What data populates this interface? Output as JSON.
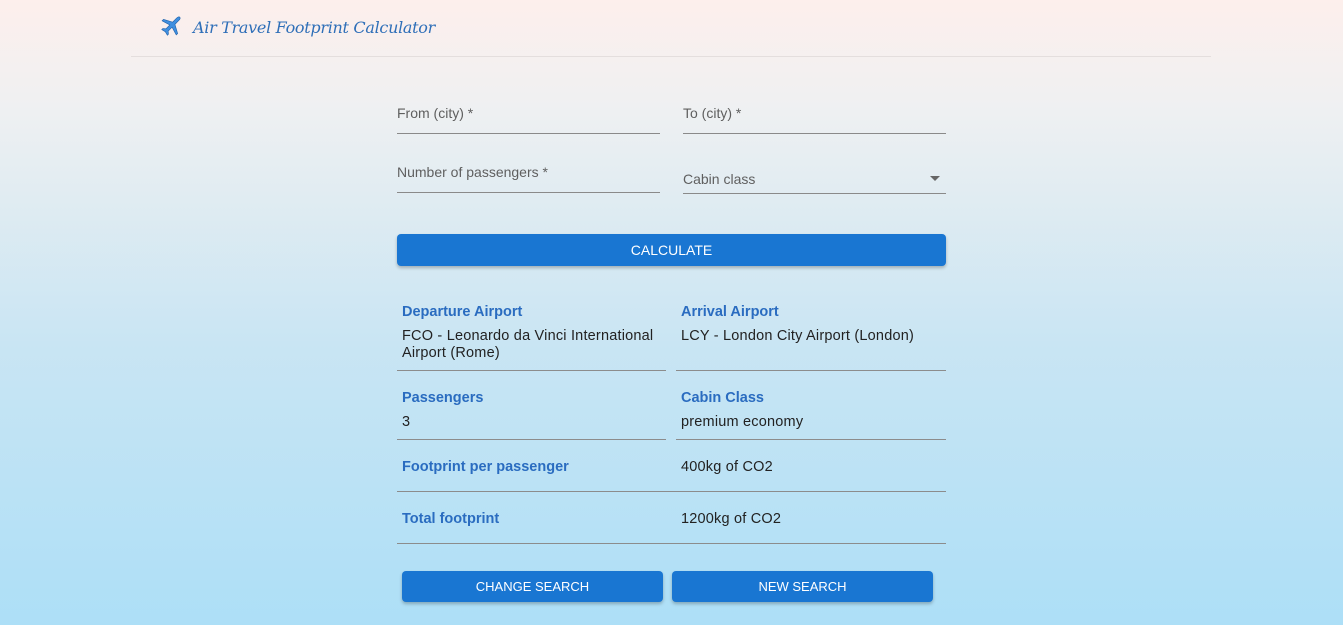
{
  "header": {
    "title": "Air Travel Footprint Calculator",
    "logo_icon": "airplane-icon"
  },
  "form": {
    "from_label": "From (city) *",
    "to_label": "To (city) *",
    "passengers_label": "Number of passengers *",
    "cabin_label": "Cabin class",
    "calculate_label": "CALCULATE"
  },
  "results": {
    "departure_label": "Departure Airport",
    "departure_value": "FCO - Leonardo da Vinci International Airport (Rome)",
    "arrival_label": "Arrival Airport",
    "arrival_value": "LCY - London City Airport (London)",
    "passengers_label": "Passengers",
    "passengers_value": "3",
    "cabin_label": "Cabin Class",
    "cabin_value": "premium economy",
    "footprint_per_label": "Footprint per passenger",
    "footprint_per_value": "400kg of CO2",
    "total_label": "Total footprint",
    "total_value": "1200kg of CO2"
  },
  "actions": {
    "change_search_label": "CHANGE SEARCH",
    "new_search_label": "NEW SEARCH"
  },
  "colors": {
    "primary": "#1976d2",
    "label_blue": "#2a6cc0"
  }
}
